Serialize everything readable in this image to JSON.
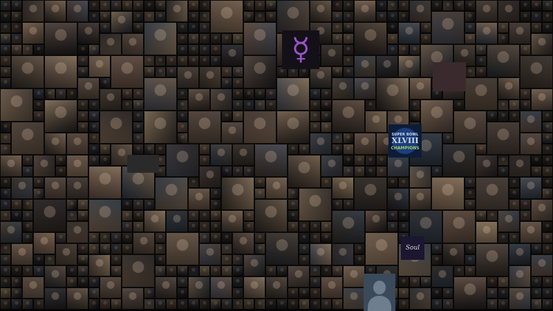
{
  "image": {
    "description_type": "photo-mosaic",
    "palette": [
      "#2b2520",
      "#3a302a",
      "#4a3c30",
      "#5a4a3c",
      "#1e1a1a",
      "#6b5644",
      "#3d3f48",
      "#28303a",
      "#544238",
      "#7a6650",
      "#222428",
      "#463a34"
    ]
  },
  "features": {
    "symbol_tile": {
      "glyph": "☿",
      "color": "#9a53c8"
    },
    "badge_tile": {
      "line1": "SUPER BOWL",
      "line2": "XLVIII",
      "line3": "CHAMPIONS"
    },
    "band_tile": {
      "text": "Soul"
    },
    "placeholder_tile": {
      "icon": "default-avatar-icon"
    }
  }
}
